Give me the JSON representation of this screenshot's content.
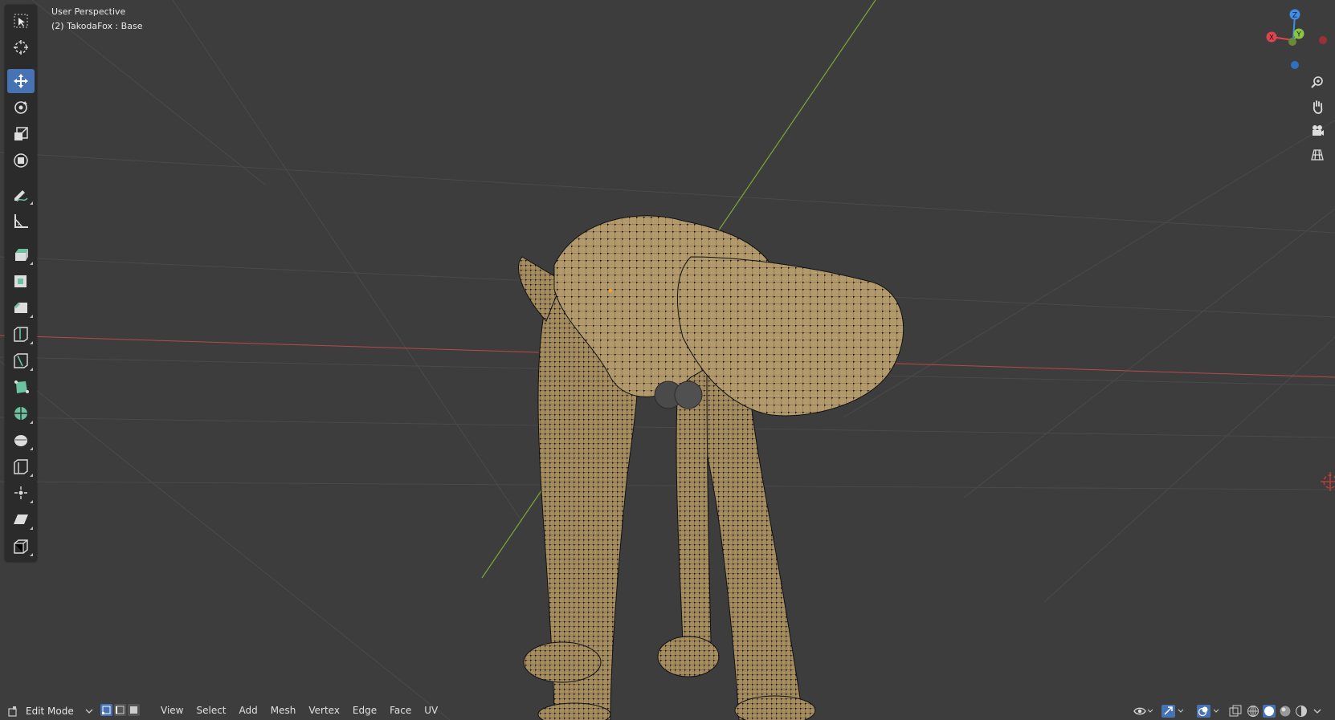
{
  "viewport": {
    "view_name": "User Perspective",
    "object_info": "(2) TakodaFox : Base",
    "background": "#3d3d3d",
    "mesh_color": "#b39a6c",
    "x_axis_color": "#b8494c",
    "y_axis_color": "#7da838"
  },
  "toolbar": {
    "tools": [
      {
        "name": "select-box-tool",
        "icon": "select-box-icon",
        "active": false
      },
      {
        "name": "cursor-tool",
        "icon": "cursor-icon",
        "active": false
      },
      {
        "name": "move-tool",
        "icon": "move-icon",
        "active": true
      },
      {
        "name": "rotate-tool",
        "icon": "rotate-icon",
        "active": false
      },
      {
        "name": "scale-tool",
        "icon": "scale-icon",
        "active": false
      },
      {
        "name": "transform-tool",
        "icon": "transform-icon",
        "active": false
      },
      {
        "name": "annotate-tool",
        "icon": "annotate-icon",
        "active": false
      },
      {
        "name": "measure-tool",
        "icon": "measure-icon",
        "active": false
      },
      {
        "name": "extrude-tool",
        "icon": "extrude-icon",
        "active": false
      },
      {
        "name": "inset-tool",
        "icon": "inset-icon",
        "active": false
      },
      {
        "name": "bevel-tool",
        "icon": "bevel-icon",
        "active": false
      },
      {
        "name": "loop-cut-tool",
        "icon": "loop-cut-icon",
        "active": false
      },
      {
        "name": "knife-tool",
        "icon": "knife-icon",
        "active": false
      },
      {
        "name": "poly-build-tool",
        "icon": "poly-build-icon",
        "active": false
      },
      {
        "name": "spin-tool",
        "icon": "spin-icon",
        "active": false
      },
      {
        "name": "smooth-tool",
        "icon": "smooth-icon",
        "active": false
      },
      {
        "name": "edge-slide-tool",
        "icon": "edge-slide-icon",
        "active": false
      },
      {
        "name": "shrink-fatten-tool",
        "icon": "shrink-fatten-icon",
        "active": false
      },
      {
        "name": "shear-tool",
        "icon": "shear-icon",
        "active": false
      },
      {
        "name": "rip-tool",
        "icon": "rip-icon",
        "active": false
      }
    ]
  },
  "gizmo": {
    "x_label": "X",
    "y_label": "Y",
    "z_label": "Z",
    "x_color": "#e0454f",
    "y_color": "#8bc53f",
    "z_color": "#3f8ee8"
  },
  "header": {
    "mode": "Edit Mode",
    "menus": [
      "View",
      "Select",
      "Add",
      "Mesh",
      "Vertex",
      "Edge",
      "Face",
      "UV"
    ]
  }
}
